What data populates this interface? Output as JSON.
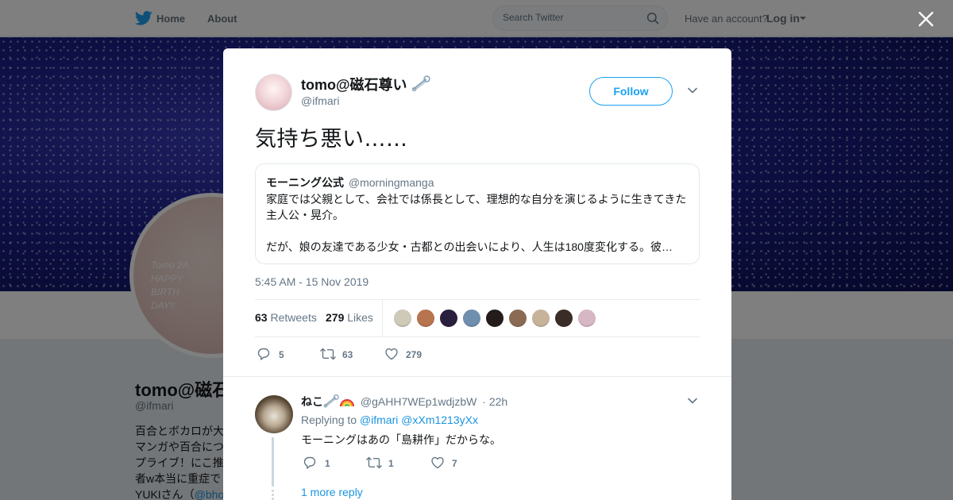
{
  "nav": {
    "home_label": "Home",
    "about_label": "About",
    "search_placeholder": "Search Twitter",
    "account_prompt": "Have an account?",
    "login_label": "Log in"
  },
  "profile": {
    "name": "tomo@磁石",
    "handle": "@ifmari",
    "avatar_text": "Tomo 2A HAPPY BIRTH DAY!!",
    "bio_lines": [
      "百合とボカロが大",
      "マンガや百合につ",
      "プライブ！にこ推",
      "者w本当に重症で"
    ],
    "bio_last_prefix": "YUKIさん（",
    "bio_last_link": "@bho"
  },
  "tweet": {
    "author_name": "tomo@磁石尊い",
    "author_handle": "@ifmari",
    "follow_label": "Follow",
    "text": "気持ち悪い……",
    "quote": {
      "name": "モーニング公式",
      "handle": "@morningmanga",
      "line1": "家庭では父親として、会社では係長として、理想的な自分を演じるように生きてきた",
      "line2": "主人公・晃介。",
      "line3": "だが、娘の友達である少女・古都との出会いにより、人生は180度変化する。彼…"
    },
    "timestamp": "5:45 AM - 15 Nov 2019",
    "retweets_count": "63",
    "retweets_label": "Retweets",
    "likes_count": "279",
    "likes_label": "Likes",
    "reply_count": "5",
    "retweet_action_count": "63",
    "like_action_count": "279",
    "liker_colors": [
      "#cfc9b8",
      "#b8734f",
      "#2a1f3d",
      "#6f8fae",
      "#241c1a",
      "#8a6a52",
      "#c7b39a",
      "#3a2d28",
      "#d7b7c4"
    ]
  },
  "reply": {
    "name": "ねこ",
    "handle": "@gAHH7WEp1wdjzbW",
    "time": "· 22h",
    "replying_prefix": "Replying to",
    "mention1": "@ifmari",
    "mention2": "@xXm1213yXx",
    "text": "モーニングはあの「島耕作」だからな。",
    "reply_count": "1",
    "retweet_count": "1",
    "like_count": "7",
    "more_replies": "1 more reply"
  },
  "colors": {
    "accent": "#1da1f2",
    "link": "#1b95e0",
    "muted": "#657786"
  }
}
